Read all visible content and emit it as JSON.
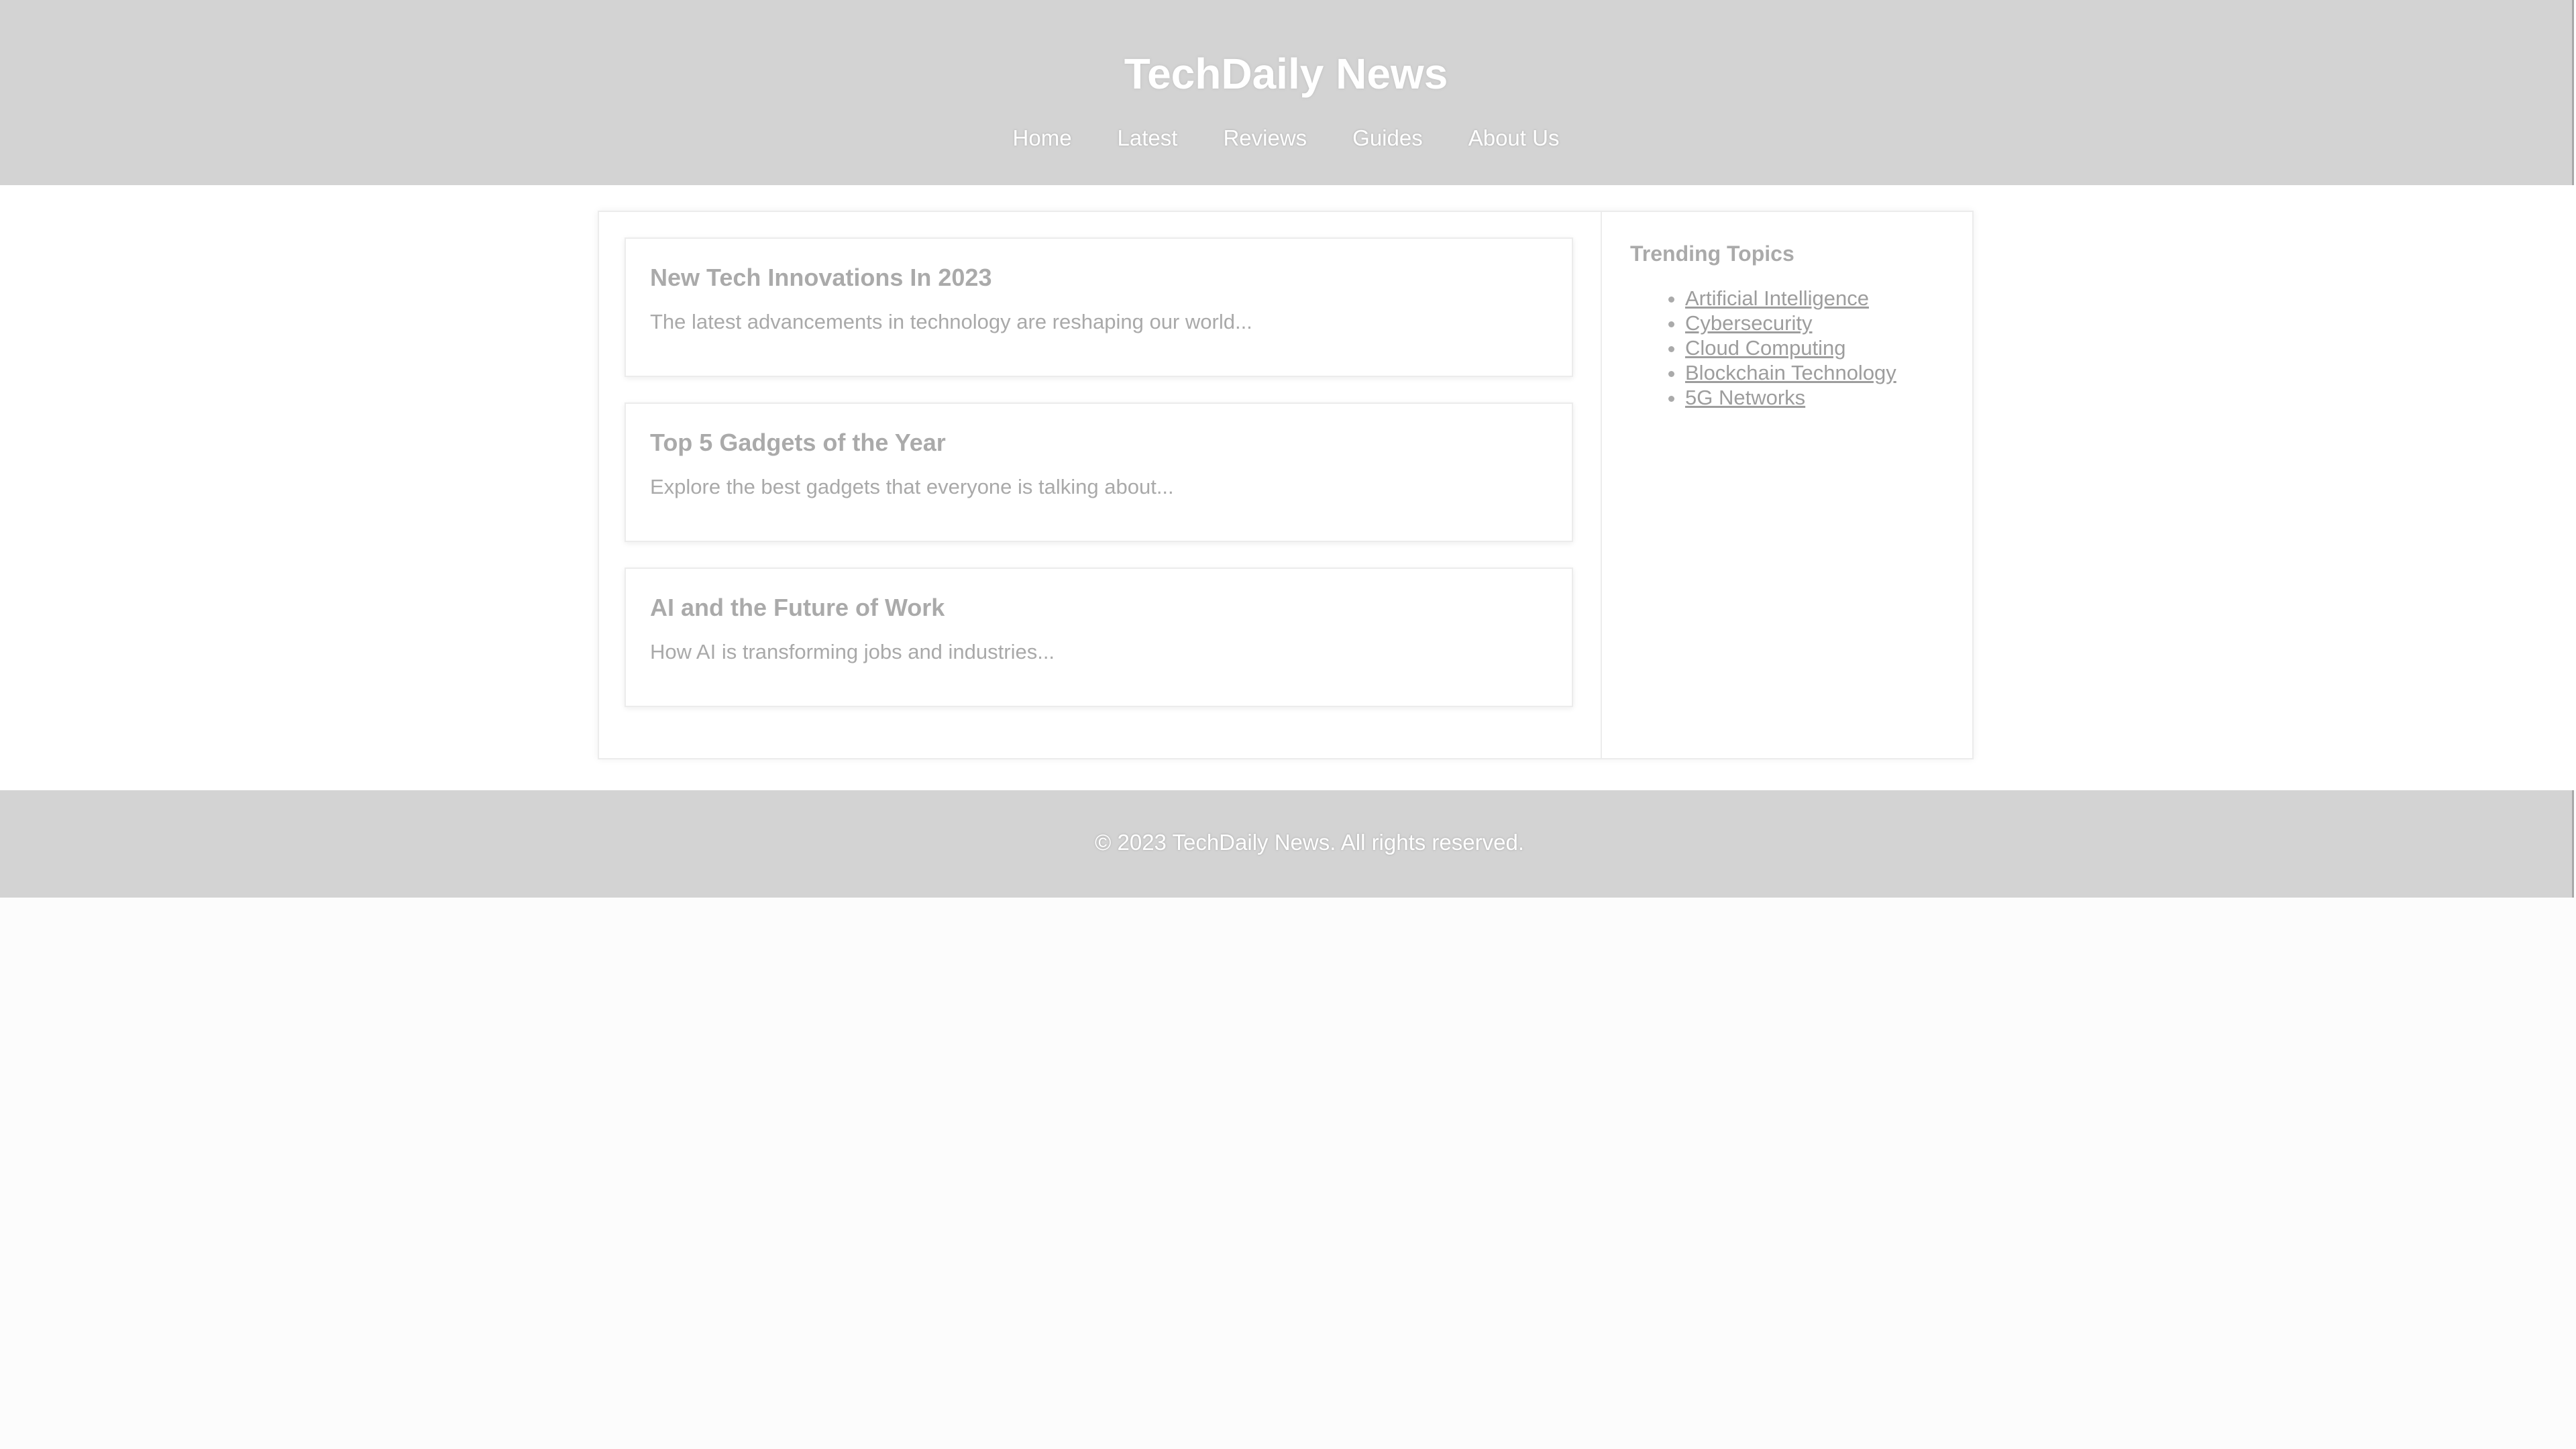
{
  "header": {
    "title": "TechDaily News",
    "nav": [
      {
        "label": "Home"
      },
      {
        "label": "Latest"
      },
      {
        "label": "Reviews"
      },
      {
        "label": "Guides"
      },
      {
        "label": "About Us"
      }
    ]
  },
  "articles": [
    {
      "title": "New Tech Innovations In 2023",
      "excerpt": "The latest advancements in technology are reshaping our world..."
    },
    {
      "title": "Top 5 Gadgets of the Year",
      "excerpt": "Explore the best gadgets that everyone is talking about..."
    },
    {
      "title": "AI and the Future of Work",
      "excerpt": "How AI is transforming jobs and industries..."
    }
  ],
  "sidebar": {
    "title": "Trending Topics",
    "topics": [
      {
        "label": "Artificial Intelligence"
      },
      {
        "label": "Cybersecurity"
      },
      {
        "label": "Cloud Computing"
      },
      {
        "label": "Blockchain Technology"
      },
      {
        "label": "5G Networks"
      }
    ]
  },
  "footer": {
    "text": "© 2023 TechDaily News. All rights reserved."
  },
  "colors": {
    "header_bg": "#d3d3d3",
    "page_bg": "#fcfcfc",
    "text_muted": "#aaaaaa"
  }
}
